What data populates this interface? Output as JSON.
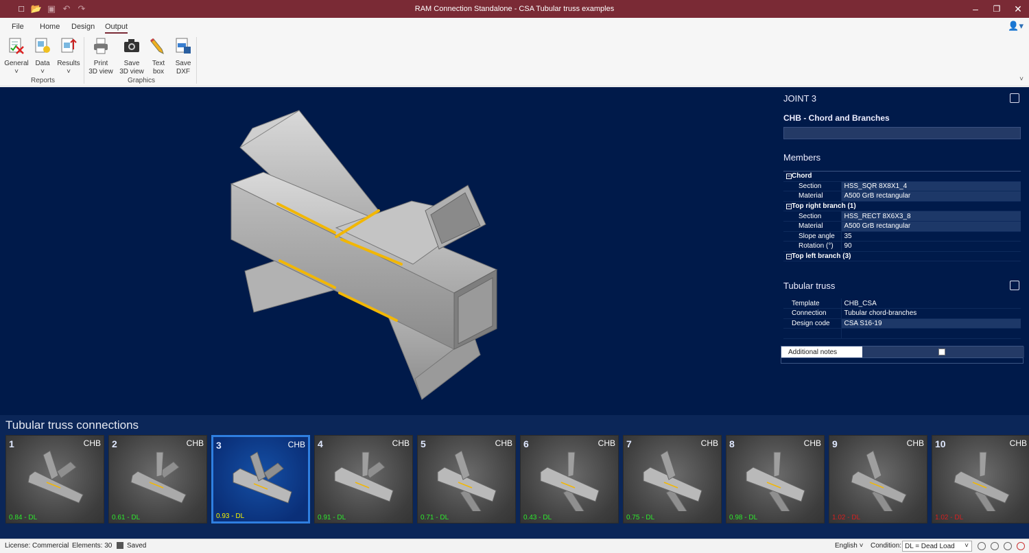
{
  "app": {
    "title": "RAM Connection Standalone - CSA Tubular truss examples"
  },
  "menu": {
    "file": "File",
    "home": "Home",
    "design": "Design",
    "output": "Output"
  },
  "ribbon": {
    "general": "General",
    "data": "Data",
    "results": "Results",
    "reports_group": "Reports",
    "print3d_l1": "Print",
    "print3d_l2": "3D view",
    "save3d_l1": "Save",
    "save3d_l2": "3D view",
    "textbox_l1": "Text",
    "textbox_l2": "box",
    "savedxf_l1": "Save",
    "savedxf_l2": "DXF",
    "graphics_group": "Graphics"
  },
  "props": {
    "joint_title": "JOINT 3",
    "type_title": "CHB - Chord and Branches",
    "members_title": "Members",
    "chord": {
      "label": "Chord",
      "section_k": "Section",
      "section_v": "HSS_SQR 8X8X1_4",
      "material_k": "Material",
      "material_v": "A500 GrB rectangular"
    },
    "trb": {
      "label": "Top right branch (1)",
      "section_k": "Section",
      "section_v": "HSS_RECT 8X6X3_8",
      "material_k": "Material",
      "material_v": "A500 GrB rectangular",
      "slope_k": "Slope angle",
      "slope_v": "35",
      "rot_k": "Rotation (°)",
      "rot_v": "90"
    },
    "tlb": {
      "label": "Top left branch (3)"
    },
    "truss_title": "Tubular truss",
    "template_k": "Template",
    "template_v": "CHB_CSA",
    "connection_k": "Connection",
    "connection_v": "Tubular chord-branches",
    "code_k": "Design code",
    "code_v": "CSA S16-19",
    "notes_k": "Additional notes"
  },
  "strip": {
    "title": "Tubular truss connections",
    "cards": [
      {
        "num": "1",
        "type": "CHB",
        "ratio": "0.84 - DL"
      },
      {
        "num": "2",
        "type": "CHB",
        "ratio": "0.61 - DL"
      },
      {
        "num": "3",
        "type": "CHB",
        "ratio": "0.93 - DL"
      },
      {
        "num": "4",
        "type": "CHB",
        "ratio": "0.91 - DL"
      },
      {
        "num": "5",
        "type": "CHB",
        "ratio": "0.71 - DL"
      },
      {
        "num": "6",
        "type": "CHB",
        "ratio": "0.43 - DL"
      },
      {
        "num": "7",
        "type": "CHB",
        "ratio": "0.75 - DL"
      },
      {
        "num": "8",
        "type": "CHB",
        "ratio": "0.98 - DL"
      },
      {
        "num": "9",
        "type": "CHB",
        "ratio": "1.02 - DL"
      },
      {
        "num": "10",
        "type": "CHB",
        "ratio": "1.02 - DL"
      }
    ]
  },
  "status": {
    "license": "License: Commercial",
    "elements": "Elements: 30",
    "saved": "Saved",
    "language": "English",
    "condition_label": "Condition:",
    "condition_value": "DL = Dead Load"
  },
  "colors": {
    "titlebar": "#7a2a35",
    "viewport_bg": "#001a4a",
    "weld": "#f2b705",
    "ok": "#2ee82e",
    "fail": "#d42020",
    "selected": "#2f7fe0"
  }
}
